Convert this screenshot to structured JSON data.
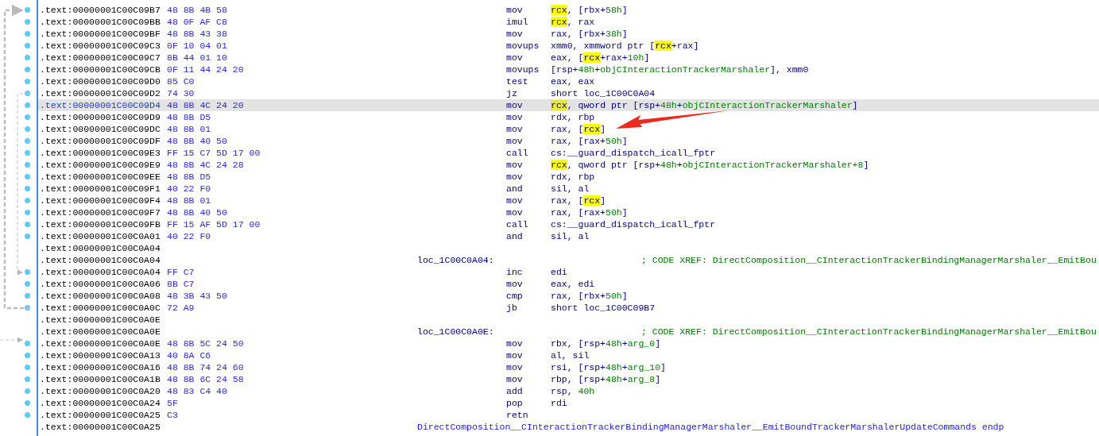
{
  "listing": {
    "rows": [
      {
        "kind": "insn",
        "address": ".text:00000001C00C09B7",
        "bytes": "48 8B 4B 58",
        "mnemonic": "mov",
        "operands": [
          {
            "text": "rcx",
            "kind": "hl"
          },
          {
            "text": ", [rbx+",
            "kind": "plain"
          },
          {
            "text": "58h",
            "kind": "name"
          },
          {
            "text": "]",
            "kind": "plain"
          }
        ],
        "selected": false
      },
      {
        "kind": "insn",
        "address": ".text:00000001C00C09BB",
        "bytes": "48 0F AF C8",
        "mnemonic": "imul",
        "operands": [
          {
            "text": "rcx",
            "kind": "hl"
          },
          {
            "text": ", rax",
            "kind": "plain"
          }
        ],
        "selected": false
      },
      {
        "kind": "insn",
        "address": ".text:00000001C00C09BF",
        "bytes": "48 8B 43 38",
        "mnemonic": "mov",
        "operands": [
          {
            "text": "rax, [rbx+",
            "kind": "plain"
          },
          {
            "text": "38h",
            "kind": "name"
          },
          {
            "text": "]",
            "kind": "plain"
          }
        ],
        "selected": false
      },
      {
        "kind": "insn",
        "address": ".text:00000001C00C09C3",
        "bytes": "0F 10 04 01",
        "mnemonic": "movups",
        "operands": [
          {
            "text": "xmm0, xmmword ptr [",
            "kind": "plain"
          },
          {
            "text": "rcx",
            "kind": "hl"
          },
          {
            "text": "+rax]",
            "kind": "plain"
          }
        ],
        "selected": false
      },
      {
        "kind": "insn",
        "address": ".text:00000001C00C09C7",
        "bytes": "8B 44 01 10",
        "mnemonic": "mov",
        "operands": [
          {
            "text": "eax, [",
            "kind": "plain"
          },
          {
            "text": "rcx",
            "kind": "hl"
          },
          {
            "text": "+rax+",
            "kind": "plain"
          },
          {
            "text": "10h",
            "kind": "name"
          },
          {
            "text": "]",
            "kind": "plain"
          }
        ],
        "selected": false
      },
      {
        "kind": "insn",
        "address": ".text:00000001C00C09CB",
        "bytes": "0F 11 44 24 20",
        "mnemonic": "movups",
        "operands": [
          {
            "text": "[rsp+",
            "kind": "plain"
          },
          {
            "text": "48h",
            "kind": "name"
          },
          {
            "text": "+",
            "kind": "plain"
          },
          {
            "text": "objCInteractionTrackerMarshaler",
            "kind": "name"
          },
          {
            "text": "], xmm0",
            "kind": "plain"
          }
        ],
        "selected": false
      },
      {
        "kind": "insn",
        "address": ".text:00000001C00C09D0",
        "bytes": "85 C0",
        "mnemonic": "test",
        "operands": [
          {
            "text": "eax, eax",
            "kind": "plain"
          }
        ],
        "selected": false
      },
      {
        "kind": "insn",
        "address": ".text:00000001C00C09D2",
        "bytes": "74 30",
        "mnemonic": "jz",
        "operands": [
          {
            "text": "short loc_1C00C0A04",
            "kind": "plain"
          }
        ],
        "selected": false
      },
      {
        "kind": "insn",
        "address": ".text:00000001C00C09D4",
        "bytes": "48 8B 4C 24 20",
        "mnemonic": "mov",
        "operands": [
          {
            "text": "rcx",
            "kind": "hl"
          },
          {
            "text": ", qword ptr [rsp+",
            "kind": "plain"
          },
          {
            "text": "48h",
            "kind": "name"
          },
          {
            "text": "+",
            "kind": "plain"
          },
          {
            "text": "objCInteractionTrackerMarshaler",
            "kind": "name"
          },
          {
            "text": "]",
            "kind": "plain"
          }
        ],
        "selected": true
      },
      {
        "kind": "insn",
        "address": ".text:00000001C00C09D9",
        "bytes": "48 8B D5",
        "mnemonic": "mov",
        "operands": [
          {
            "text": "rdx, rbp",
            "kind": "plain"
          }
        ],
        "selected": false
      },
      {
        "kind": "insn",
        "address": ".text:00000001C00C09DC",
        "bytes": "48 8B 01",
        "mnemonic": "mov",
        "operands": [
          {
            "text": "rax, [",
            "kind": "plain"
          },
          {
            "text": "rcx",
            "kind": "hl"
          },
          {
            "text": "]",
            "kind": "plain"
          }
        ],
        "selected": false
      },
      {
        "kind": "insn",
        "address": ".text:00000001C00C09DF",
        "bytes": "48 8B 40 50",
        "mnemonic": "mov",
        "operands": [
          {
            "text": "rax, [rax+",
            "kind": "plain"
          },
          {
            "text": "50h",
            "kind": "name"
          },
          {
            "text": "]",
            "kind": "plain"
          }
        ],
        "selected": false
      },
      {
        "kind": "insn",
        "address": ".text:00000001C00C09E3",
        "bytes": "FF 15 C7 5D 17 00",
        "mnemonic": "call",
        "operands": [
          {
            "text": "cs:__guard_dispatch_icall_fptr",
            "kind": "plain"
          }
        ],
        "selected": false
      },
      {
        "kind": "insn",
        "address": ".text:00000001C00C09E9",
        "bytes": "48 8B 4C 24 28",
        "mnemonic": "mov",
        "operands": [
          {
            "text": "rcx",
            "kind": "hl"
          },
          {
            "text": ", qword ptr [rsp+",
            "kind": "plain"
          },
          {
            "text": "48h",
            "kind": "name"
          },
          {
            "text": "+",
            "kind": "plain"
          },
          {
            "text": "objCInteractionTrackerMarshaler+8",
            "kind": "name"
          },
          {
            "text": "]",
            "kind": "plain"
          }
        ],
        "selected": false
      },
      {
        "kind": "insn",
        "address": ".text:00000001C00C09EE",
        "bytes": "48 8B D5",
        "mnemonic": "mov",
        "operands": [
          {
            "text": "rdx, rbp",
            "kind": "plain"
          }
        ],
        "selected": false
      },
      {
        "kind": "insn",
        "address": ".text:00000001C00C09F1",
        "bytes": "40 22 F0",
        "mnemonic": "and",
        "operands": [
          {
            "text": "sil, al",
            "kind": "plain"
          }
        ],
        "selected": false
      },
      {
        "kind": "insn",
        "address": ".text:00000001C00C09F4",
        "bytes": "48 8B 01",
        "mnemonic": "mov",
        "operands": [
          {
            "text": "rax, [",
            "kind": "plain"
          },
          {
            "text": "rcx",
            "kind": "hl"
          },
          {
            "text": "]",
            "kind": "plain"
          }
        ],
        "selected": false
      },
      {
        "kind": "insn",
        "address": ".text:00000001C00C09F7",
        "bytes": "48 8B 40 50",
        "mnemonic": "mov",
        "operands": [
          {
            "text": "rax, [rax+",
            "kind": "plain"
          },
          {
            "text": "50h",
            "kind": "name"
          },
          {
            "text": "]",
            "kind": "plain"
          }
        ],
        "selected": false
      },
      {
        "kind": "insn",
        "address": ".text:00000001C00C09FB",
        "bytes": "FF 15 AF 5D 17 00",
        "mnemonic": "call",
        "operands": [
          {
            "text": "cs:__guard_dispatch_icall_fptr",
            "kind": "plain"
          }
        ],
        "selected": false
      },
      {
        "kind": "insn",
        "address": ".text:00000001C00C0A01",
        "bytes": "40 22 F0",
        "mnemonic": "and",
        "operands": [
          {
            "text": "sil, al",
            "kind": "plain"
          }
        ],
        "selected": false
      },
      {
        "kind": "blank",
        "address": ".text:00000001C00C0A04",
        "selected": false
      },
      {
        "kind": "label",
        "address": ".text:00000001C00C0A04",
        "label": "loc_1C00C0A04:",
        "comment": "; CODE XREF: DirectComposition__CInteractionTrackerBindingManagerMarshaler__EmitBou",
        "selected": false
      },
      {
        "kind": "insn",
        "address": ".text:00000001C00C0A04",
        "bytes": "FF C7",
        "mnemonic": "inc",
        "operands": [
          {
            "text": "edi",
            "kind": "plain"
          }
        ],
        "selected": false
      },
      {
        "kind": "insn",
        "address": ".text:00000001C00C0A06",
        "bytes": "8B C7",
        "mnemonic": "mov",
        "operands": [
          {
            "text": "eax, edi",
            "kind": "plain"
          }
        ],
        "selected": false
      },
      {
        "kind": "insn",
        "address": ".text:00000001C00C0A08",
        "bytes": "48 3B 43 50",
        "mnemonic": "cmp",
        "operands": [
          {
            "text": "rax, [rbx+",
            "kind": "plain"
          },
          {
            "text": "50h",
            "kind": "name"
          },
          {
            "text": "]",
            "kind": "plain"
          }
        ],
        "selected": false
      },
      {
        "kind": "insn",
        "address": ".text:00000001C00C0A0C",
        "bytes": "72 A9",
        "mnemonic": "jb",
        "operands": [
          {
            "text": "short loc_1C00C09B7",
            "kind": "plain"
          }
        ],
        "selected": false
      },
      {
        "kind": "blank",
        "address": ".text:00000001C00C0A0E",
        "selected": false
      },
      {
        "kind": "label",
        "address": ".text:00000001C00C0A0E",
        "label": "loc_1C00C0A0E:",
        "comment": "; CODE XREF: DirectComposition__CInteractionTrackerBindingManagerMarshaler__EmitBou",
        "selected": false
      },
      {
        "kind": "insn",
        "address": ".text:00000001C00C0A0E",
        "bytes": "48 8B 5C 24 50",
        "mnemonic": "mov",
        "operands": [
          {
            "text": "rbx, [rsp+",
            "kind": "plain"
          },
          {
            "text": "48h",
            "kind": "name"
          },
          {
            "text": "+",
            "kind": "plain"
          },
          {
            "text": "arg_0",
            "kind": "name"
          },
          {
            "text": "]",
            "kind": "plain"
          }
        ],
        "selected": false
      },
      {
        "kind": "insn",
        "address": ".text:00000001C00C0A13",
        "bytes": "40 8A C6",
        "mnemonic": "mov",
        "operands": [
          {
            "text": "al, sil",
            "kind": "plain"
          }
        ],
        "selected": false
      },
      {
        "kind": "insn",
        "address": ".text:00000001C00C0A16",
        "bytes": "48 8B 74 24 60",
        "mnemonic": "mov",
        "operands": [
          {
            "text": "rsi, [rsp+",
            "kind": "plain"
          },
          {
            "text": "48h",
            "kind": "name"
          },
          {
            "text": "+",
            "kind": "plain"
          },
          {
            "text": "arg_10",
            "kind": "name"
          },
          {
            "text": "]",
            "kind": "plain"
          }
        ],
        "selected": false
      },
      {
        "kind": "insn",
        "address": ".text:00000001C00C0A1B",
        "bytes": "48 8B 6C 24 58",
        "mnemonic": "mov",
        "operands": [
          {
            "text": "rbp, [rsp+",
            "kind": "plain"
          },
          {
            "text": "48h",
            "kind": "name"
          },
          {
            "text": "+",
            "kind": "plain"
          },
          {
            "text": "arg_8",
            "kind": "name"
          },
          {
            "text": "]",
            "kind": "plain"
          }
        ],
        "selected": false
      },
      {
        "kind": "insn",
        "address": ".text:00000001C00C0A20",
        "bytes": "48 83 C4 40",
        "mnemonic": "add",
        "operands": [
          {
            "text": "rsp, ",
            "kind": "plain"
          },
          {
            "text": "40h",
            "kind": "name"
          }
        ],
        "selected": false
      },
      {
        "kind": "insn",
        "address": ".text:00000001C00C0A24",
        "bytes": "5F",
        "mnemonic": "pop",
        "operands": [
          {
            "text": "rdi",
            "kind": "plain"
          }
        ],
        "selected": false
      },
      {
        "kind": "insn",
        "address": ".text:00000001C00C0A25",
        "bytes": "C3",
        "mnemonic": "retn",
        "operands": [],
        "selected": false
      },
      {
        "kind": "endp",
        "address": ".text:00000001C00C0A25",
        "label": "DirectComposition__CInteractionTrackerBindingManagerMarshaler__EmitBoundTrackerMarshalerUpdateCommands endp",
        "selected": false
      }
    ]
  }
}
